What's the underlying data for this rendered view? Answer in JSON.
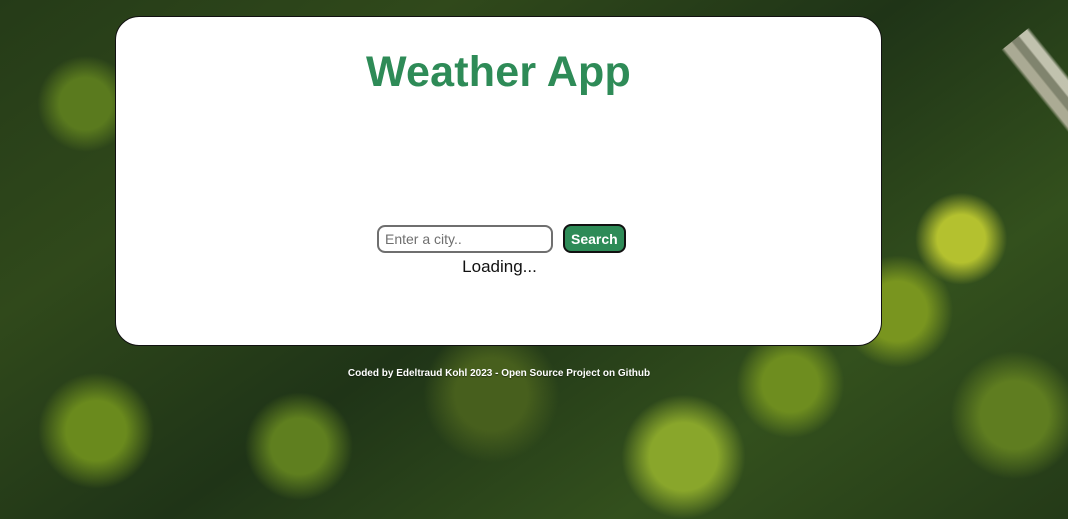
{
  "app": {
    "title": "Weather App"
  },
  "search": {
    "placeholder": "Enter a city..",
    "value": "",
    "button_label": "Search"
  },
  "status": {
    "loading_text": "Loading..."
  },
  "footer": {
    "text": "Coded by Edeltraud Kohl 2023 - Open Source Project on Github"
  },
  "theme": {
    "accent": "#2e8b57",
    "card_background": "#ffffff",
    "border_color": "#111111"
  }
}
